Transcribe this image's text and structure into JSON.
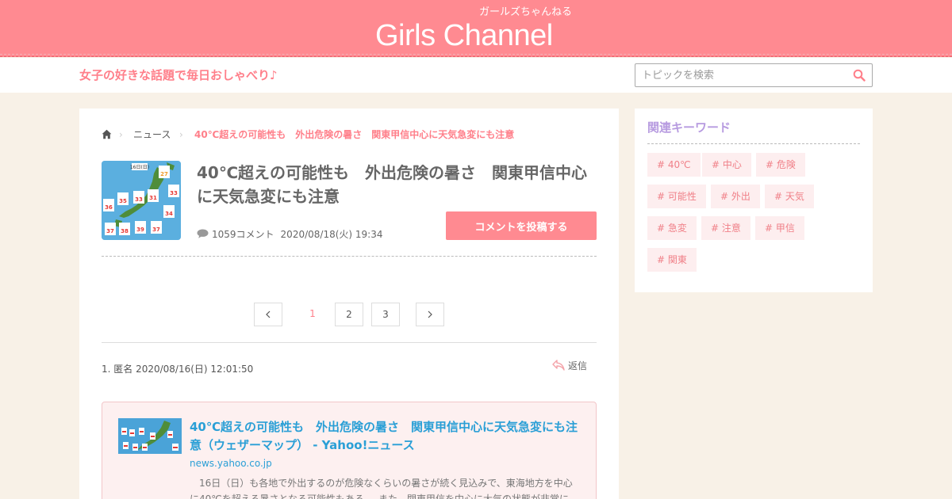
{
  "header": {
    "logo_text": "Girls Channel",
    "logo_kana": "ガールズちゃんねる",
    "tagline": "女子の好きな話題で毎日おしゃべり♪"
  },
  "search": {
    "placeholder": "トピックを検索",
    "value": ""
  },
  "breadcrumb": {
    "home_icon": "home-icon",
    "items": [
      "ニュース",
      "40℃超えの可能性も　外出危険の暑さ　関東甲信中心に天気急変にも注意"
    ]
  },
  "topic": {
    "title": "40℃超えの可能性も　外出危険の暑さ　関東甲信中心に天気急変にも注意",
    "comment_count": "1059コメント",
    "date": "2020/08/18(火) 19:34",
    "post_button": "コメントを投稿する",
    "thumb_date_label": "16日(日)",
    "thumb_temps": [
      "27",
      "33",
      "35",
      "33",
      "31",
      "36",
      "34",
      "37",
      "38",
      "39",
      "37"
    ]
  },
  "pagination": {
    "prev_icon": "chevron-left-icon",
    "next_icon": "chevron-right-icon",
    "pages": [
      "1",
      "2",
      "3"
    ],
    "current": "1"
  },
  "comment": {
    "header": "1. 匿名 2020/08/16(日) 12:01:50",
    "reply_label": "返信",
    "link": {
      "title": "40℃超えの可能性も　外出危険の暑さ　関東甲信中心に天気急変にも注意（ウェザーマップ） - Yahoo!ニュース",
      "domain": "news.yahoo.co.jp",
      "description": "　16日（日）も各地で外出するのが危険なくらいの暑さが続く見込みで、東海地方を中心に40℃を超える暑さとなる可能性もある。　また、関東甲信を中心に大気の状態が非常に"
    }
  },
  "sidebar": {
    "title": "関連キーワード",
    "keywords": [
      "# 40℃",
      "# 中心",
      "# 危険",
      "# 可能性",
      "# 外出",
      "# 天気",
      "# 急変",
      "# 注意",
      "# 甲信",
      "# 関東"
    ]
  },
  "colors": {
    "header_bg": "#ff8a91",
    "accent": "#ff7f8a",
    "link": "#2a9fd6",
    "keyword_title": "#b79be0",
    "page_bg": "#f8f1e7"
  }
}
